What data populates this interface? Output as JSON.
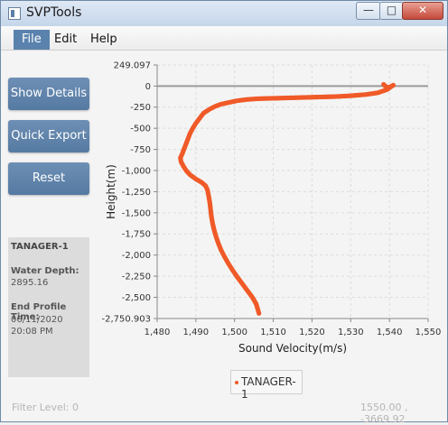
{
  "window": {
    "title": "SVPTools",
    "minimize_icon": "minimize-icon",
    "maximize_icon": "maximize-icon",
    "close_icon": "close-icon"
  },
  "menu": [
    "File",
    "Edit",
    "Help"
  ],
  "sidebar": {
    "buttons": [
      "Show Details",
      "Quick Export",
      "Reset"
    ],
    "info": {
      "title": "TANAGER-1",
      "water_depth_label": "Water Depth:",
      "water_depth_value": "2895.16",
      "end_time_label": "End Profile Time:",
      "end_date": "06/11/2020",
      "end_time": "20:08 PM"
    }
  },
  "status": {
    "filter_level": "Filter Level: 0",
    "cursor": "1550.00 , -3669.92"
  },
  "colors": {
    "series": "#f05a28",
    "button": "#5f84ad",
    "menu_selected": "#5a82ad"
  },
  "chart_data": {
    "type": "scatter",
    "xlabel": "Sound Velocity(m/s)",
    "ylabel": "Height(m)",
    "xlim": [
      1480,
      1550
    ],
    "ylim": [
      -2750.903,
      249.097
    ],
    "x_ticks": [
      "1,480",
      "1,490",
      "1,500",
      "1,510",
      "1,520",
      "1,530",
      "1,540",
      "1,550"
    ],
    "y_ticks": [
      {
        "v": 249.097,
        "label": "249.097"
      },
      {
        "v": 0,
        "label": "0"
      },
      {
        "v": -250,
        "label": "-250"
      },
      {
        "v": -500,
        "label": "-500"
      },
      {
        "v": -750,
        "label": "-750"
      },
      {
        "v": -1000,
        "label": "-1,000"
      },
      {
        "v": -1250,
        "label": "-1,250"
      },
      {
        "v": -1500,
        "label": "-1,500"
      },
      {
        "v": -1750,
        "label": "-1,750"
      },
      {
        "v": -2000,
        "label": "-2,000"
      },
      {
        "v": -2250,
        "label": "-2,250"
      },
      {
        "v": -2500,
        "label": "-2,500"
      },
      {
        "v": -2750.903,
        "label": "-2,750.903"
      }
    ],
    "zero_line": true,
    "grid": true,
    "legend": "bottom-center",
    "series": [
      {
        "name": "TANAGER-1",
        "color": "#f05a28",
        "x": [
          1538.5,
          1538.8,
          1539.2,
          1540.0,
          1540.5,
          1541.0,
          1540.6,
          1539.5,
          1537.0,
          1534.0,
          1530.0,
          1526.0,
          1522.0,
          1518.0,
          1514.0,
          1510.0,
          1506.0,
          1503.0,
          1500.5,
          1498.5,
          1496.5,
          1495.0,
          1493.5,
          1492.0,
          1491.0,
          1490.0,
          1489.2,
          1488.5,
          1488.0,
          1487.5,
          1487.0,
          1486.5,
          1486.0,
          1486.2,
          1486.8,
          1487.5,
          1488.5,
          1490.0,
          1491.5,
          1492.5,
          1493.0,
          1493.3,
          1493.6,
          1493.8,
          1494.0,
          1494.3,
          1494.7,
          1495.2,
          1495.8,
          1496.5,
          1497.4,
          1498.4,
          1499.5,
          1500.7,
          1502.0,
          1503.3,
          1504.6,
          1505.6,
          1506.3
        ],
        "y": [
          20,
          5,
          -10,
          -15,
          -5,
          10,
          0,
          -40,
          -80,
          -100,
          -115,
          -125,
          -130,
          -135,
          -140,
          -145,
          -150,
          -160,
          -175,
          -195,
          -215,
          -240,
          -275,
          -320,
          -380,
          -440,
          -500,
          -560,
          -620,
          -680,
          -740,
          -800,
          -850,
          -900,
          -950,
          -1000,
          -1050,
          -1100,
          -1140,
          -1180,
          -1230,
          -1300,
          -1380,
          -1460,
          -1540,
          -1620,
          -1700,
          -1780,
          -1860,
          -1940,
          -2020,
          -2100,
          -2180,
          -2260,
          -2340,
          -2420,
          -2500,
          -2580,
          -2690
        ]
      }
    ]
  }
}
